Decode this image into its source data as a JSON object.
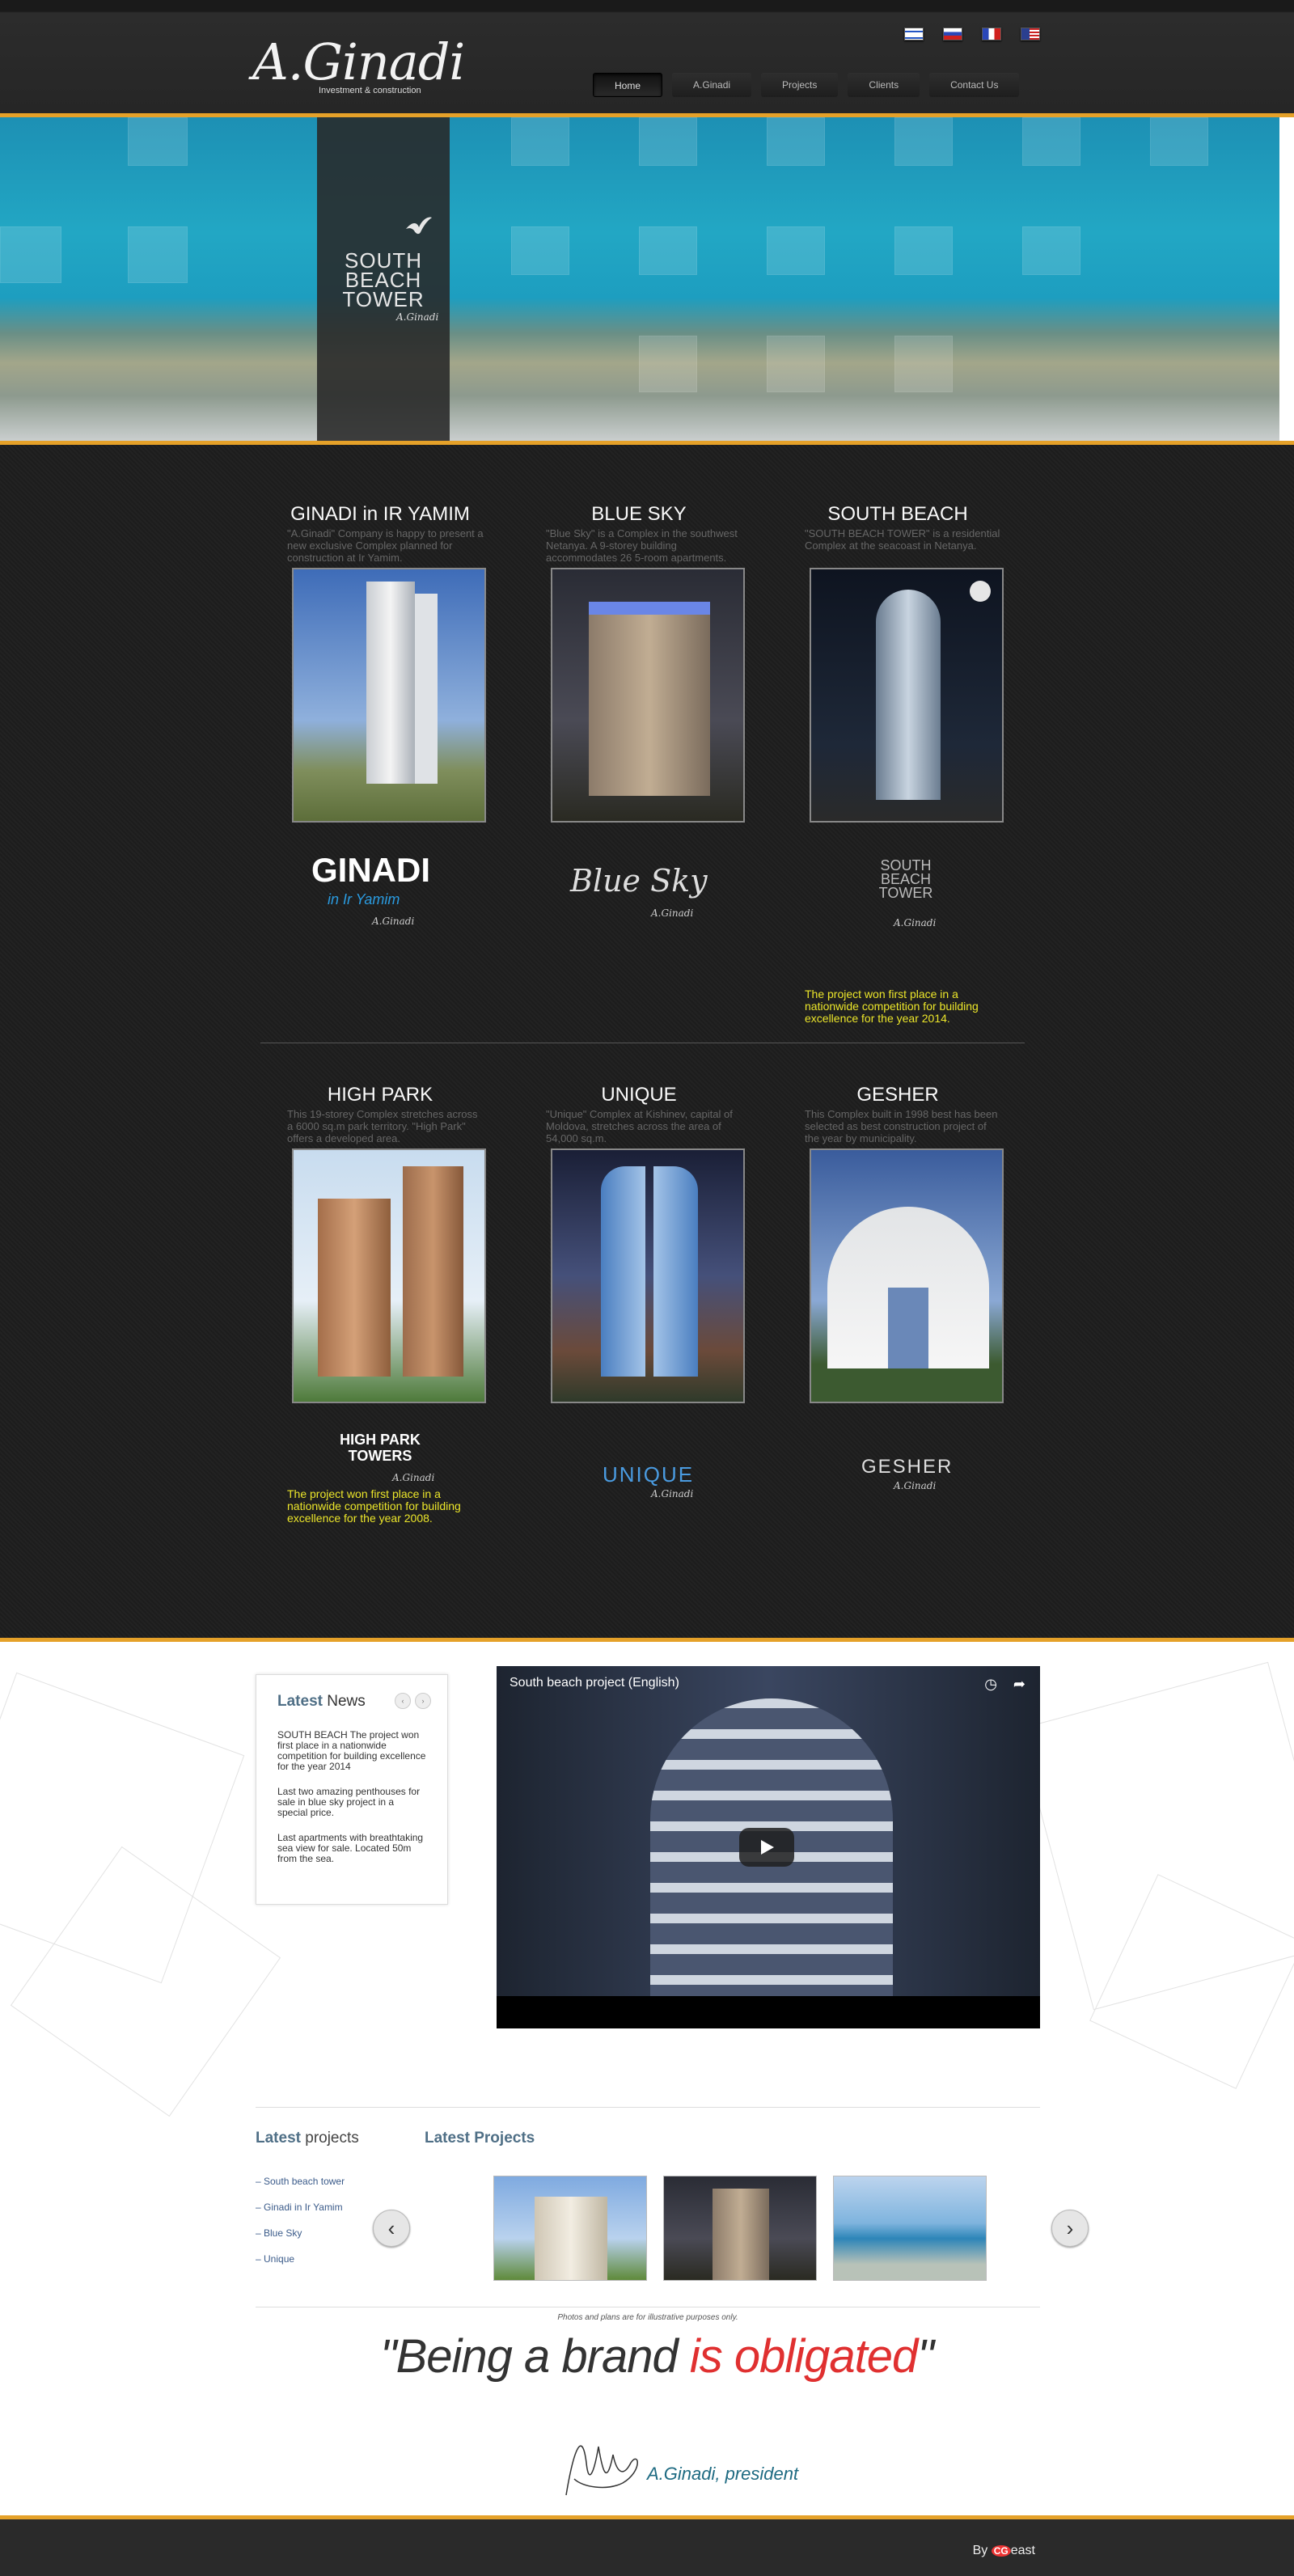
{
  "brand": {
    "logo": "A.Ginadi",
    "tagline": "Investment & construction"
  },
  "flags": [
    "israel-flag-icon",
    "russia-flag-icon",
    "france-flag-icon",
    "usa-flag-icon"
  ],
  "nav": [
    "Home",
    "A.Ginadi",
    "Projects",
    "Clients",
    "Contact Us"
  ],
  "banner": {
    "tower_line1": "SOUTH",
    "tower_line2": "BEACH",
    "tower_line3": "TOWER",
    "signature": "A.Ginadi"
  },
  "projects": [
    {
      "title": "GINADI in IR YAMIM",
      "desc": "\"A.Ginadi\" Company is happy to present a new exclusive Complex planned for construction at Ir Yamim.",
      "logo": "GINADI",
      "logo_sub": "in Ir Yamim",
      "logo_sig": "A.Ginadi",
      "award": ""
    },
    {
      "title": "BLUE SKY",
      "desc": "\"Blue Sky\" is a Complex in the southwest Netanya. A 9-storey building accommodates 26 5-room apartments.",
      "logo": "Blue Sky",
      "logo_sub": "",
      "logo_sig": "A.Ginadi",
      "award": ""
    },
    {
      "title": "SOUTH BEACH",
      "desc": "\"SOUTH BEACH TOWER\" is a residential Complex at the seacoast in Netanya.",
      "logo": "SOUTH BEACH TOWER",
      "logo_sub": "",
      "logo_sig": "A.Ginadi",
      "award": "The project won first place in a nationwide competition for building excellence for the year 2014."
    },
    {
      "title": "HIGH PARK",
      "desc": "This 19-storey Complex stretches across a 6000 sq.m park territory. \"High Park\" offers a developed area.",
      "logo": "HIGH PARK TOWERS",
      "logo_sub": "",
      "logo_sig": "A.Ginadi",
      "award": "The project won first place in a nationwide competition for building excellence for the year 2008."
    },
    {
      "title": "UNIQUE",
      "desc": "\"Unique\" Complex at Kishinev, capital of Moldova, stretches across the area of 54,000 sq.m.",
      "logo": "UNIQUE",
      "logo_sub": "",
      "logo_sig": "A.Ginadi",
      "award": ""
    },
    {
      "title": "GESHER",
      "desc": "This Complex built in 1998 best has been selected as best construction project of the year by municipality.",
      "logo": "GESHER",
      "logo_sub": "",
      "logo_sig": "A.Ginadi",
      "award": ""
    }
  ],
  "news": {
    "head_bold": "Latest",
    "head_rest": " News",
    "prev": "‹",
    "next": "›",
    "items": [
      "SOUTH BEACH The project won first place in a nationwide competition for building excellence for the year 2014",
      "Last two amazing penthouses for sale in blue sky project in a special price.",
      "Last apartments with breathtaking sea view for sale. Located 50m from the sea."
    ]
  },
  "video": {
    "title": "South beach project (English)",
    "clock_icon": "clock-icon",
    "share_icon": "share-icon"
  },
  "latest_projects_list": {
    "head_bold": "Latest",
    "head_rest": " projects",
    "items": [
      "– South beach tower",
      "– Ginadi in Ir Yamim",
      "– Blue Sky",
      "– Unique"
    ]
  },
  "latest_projects_gallery": {
    "head": "Latest Projects",
    "prev": "‹",
    "next": "›"
  },
  "disclaimer": "Photos and plans are for illustrative purposes only.",
  "slogan": {
    "part1": "\"Being a brand ",
    "part2": "is obligated",
    "part3": "\""
  },
  "president": "A.Ginadi, president",
  "footer": {
    "by": "By ",
    "brand_mark": "CG",
    "brand_rest": "east"
  },
  "colors": {
    "accent": "#e5a129",
    "award": "#ece62a",
    "link": "#3b5b8a",
    "slogan_red": "#e03030"
  }
}
